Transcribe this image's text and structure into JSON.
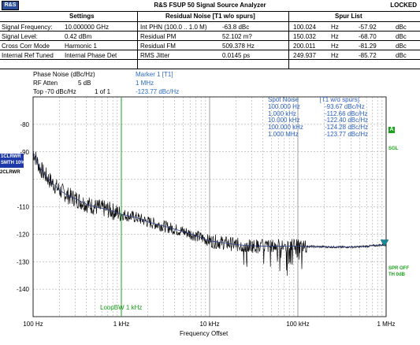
{
  "app": {
    "title": "R&S FSUP 50 Signal Source Analyzer",
    "logo": "R&S",
    "status": "LOCKED"
  },
  "headers": {
    "settings": "Settings",
    "residual": "Residual Noise [T1 w/o spurs]",
    "spur": "Spur List"
  },
  "rows": [
    {
      "label": "Signal Frequency:",
      "value": "10.000000 GHz",
      "res_label": "Int PHN (100.0 .. 1.0 M)",
      "res_value": "-63.8 dBc",
      "spur_freq": "100.024",
      "spur_unit": "Hz",
      "spur_level": "-57.92",
      "spur_level_unit": "dBc"
    },
    {
      "label": "Signal Level:",
      "value": "0.42 dBm",
      "res_label": "Residual PM",
      "res_value": "52.102 m?",
      "spur_freq": "150.032",
      "spur_unit": "Hz",
      "spur_level": "-68.70",
      "spur_level_unit": "dBc"
    },
    {
      "label": "Cross Corr Mode",
      "value": "Harmonic 1",
      "res_label": "Residual FM",
      "res_value": "509.378 Hz",
      "spur_freq": "200.011",
      "spur_unit": "Hz",
      "spur_level": "-81.29",
      "spur_level_unit": "dBc"
    },
    {
      "label": "Internal Ref Tuned",
      "value": "Internal Phase Det",
      "res_label": "RMS Jitter",
      "res_value": "0.0145 ps",
      "spur_freq": "249.937",
      "spur_unit": "Hz",
      "spur_level": "-85.72",
      "spur_level_unit": "dBc"
    }
  ],
  "settings": {
    "phase_noise": "Phase Noise (dBc/Hz)",
    "rf_atten_label": "RF Atten",
    "rf_atten_value": "5 dB",
    "top": "Top  -70 dBc/Hz",
    "page": "1 of 1"
  },
  "marker": {
    "name": "Marker 1 [T1]",
    "freq": "1 MHz",
    "value": "-123.77 dBc/Hz"
  },
  "marker_table": {
    "col1": "Spot Noise",
    "col2": "[T1 w/o spurs]",
    "rows": [
      {
        "freq": "100.000 Hz",
        "val": "-93.67 dBc/Hz"
      },
      {
        "freq": "1.000 kHz",
        "val": "-112.66 dBc/Hz"
      },
      {
        "freq": "10.000 kHz",
        "val": "-122.40 dBc/Hz"
      },
      {
        "freq": "100.000 kHz",
        "val": "-124.28 dBc/Hz"
      },
      {
        "freq": "1.000 MHz",
        "val": "-123.77 dBc/Hz"
      }
    ]
  },
  "side_labels": {
    "trace1_a": "1CLRWR",
    "trace1_b": "SMTH 10%",
    "trace2": "2CLRWR",
    "a": "A",
    "sgl": "SGL",
    "spr_off": "SPR OFF",
    "th": "TH 0dB"
  },
  "loop_bw": "LoopBW 1 kHz",
  "chart_data": {
    "type": "line",
    "xlabel": "Frequency Offset",
    "ylabel": "",
    "x_scale": "log",
    "xlim": [
      100,
      1000000
    ],
    "ylim": [
      -150,
      -70
    ],
    "y_ticks": [
      -80,
      -90,
      -110,
      -120,
      -130,
      -140
    ],
    "x_ticks": [
      {
        "value": 100,
        "label": "100 Hz"
      },
      {
        "value": 1000,
        "label": "1 kHz"
      },
      {
        "value": 10000,
        "label": "10 kHz"
      },
      {
        "value": 100000,
        "label": "100 kHz"
      },
      {
        "value": 1000000,
        "label": "1 MHz"
      }
    ],
    "colors": {
      "trace": "#101010",
      "marker": "#2a6ac8",
      "loop": "#19a319",
      "grid": "#9a9a9a"
    },
    "series": [
      {
        "x": [
          100,
          120,
          150,
          200,
          250,
          300,
          400,
          500,
          700,
          1000,
          1500,
          2000,
          3000,
          5000,
          7000,
          10000,
          15000,
          20000,
          30000,
          50000,
          70000,
          100000,
          150000,
          200000,
          300000,
          500000,
          700000,
          1000000
        ],
        "y": [
          -90,
          -96,
          -100,
          -104,
          -106,
          -107,
          -109,
          -110,
          -111,
          -112.7,
          -114,
          -115.5,
          -117,
          -119,
          -120.5,
          -122.4,
          -123.2,
          -123.8,
          -124.2,
          -124.4,
          -124.3,
          -124.3,
          -124.5,
          -124.6,
          -124.7,
          -124.6,
          -124.2,
          -123.8
        ]
      }
    ],
    "annotations": [
      {
        "type": "vline",
        "x": 1000,
        "label": "LoopBW 1 kHz"
      },
      {
        "type": "marker",
        "x": 1000000,
        "y": -123.77,
        "label": "T1"
      }
    ]
  }
}
